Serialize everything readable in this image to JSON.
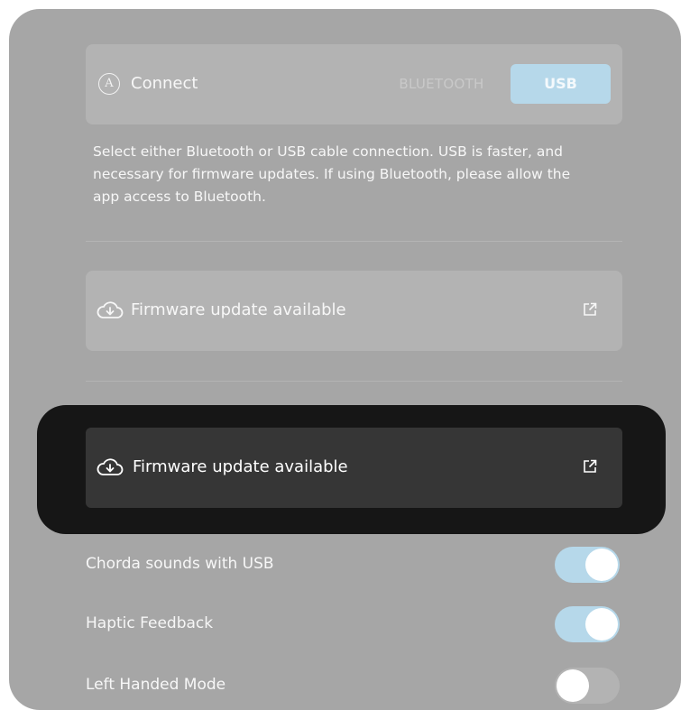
{
  "connect": {
    "icon": "a-circle-icon",
    "title": "Connect",
    "options": {
      "bluetooth": "BLUETOOTH",
      "usb": "USB"
    },
    "selected": "USB",
    "description": "Select either Bluetooth or USB cable connection. USB is faster, and necessary for firmware updates. If using Bluetooth, please allow the app access to Bluetooth."
  },
  "firmware": {
    "label": "Firmware update available",
    "icon": "cloud-download-icon",
    "action_icon": "external-link-icon"
  },
  "highlight": {
    "label": "Firmware update available",
    "icon": "cloud-download-icon",
    "action_icon": "external-link-icon"
  },
  "settings": [
    {
      "label": "Chorda sounds with USB",
      "enabled": true
    },
    {
      "label": "Haptic Feedback",
      "enabled": true
    },
    {
      "label": "Left Handed Mode",
      "enabled": false
    }
  ],
  "colors": {
    "panel": "#a6a6a6",
    "card": "#b3b3b3",
    "accent": "#b6d8ea",
    "highlight_bg": "#161616",
    "highlight_card": "#363636"
  }
}
